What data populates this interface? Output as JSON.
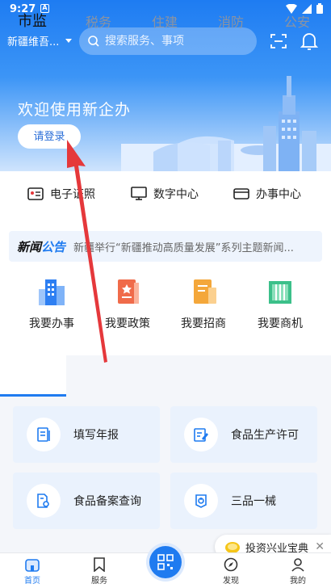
{
  "status_bar": {
    "time": "9:27",
    "badge": "A"
  },
  "header": {
    "region": "新疆维吾...",
    "search_placeholder": "搜索服务、事项"
  },
  "hero": {
    "welcome": "欢迎使用新企办",
    "login_label": "请登录"
  },
  "services": [
    {
      "label": "电子证照",
      "icon": "license-card-icon"
    },
    {
      "label": "数字中心",
      "icon": "monitor-icon"
    },
    {
      "label": "办事中心",
      "icon": "wallet-icon"
    }
  ],
  "news": {
    "tag_a": "新闻",
    "tag_b": "公告",
    "text": "新疆举行“新疆推动高质量发展”系列主题新闻..."
  },
  "quick_actions": [
    {
      "label": "我要办事",
      "icon": "building-icon"
    },
    {
      "label": "我要政策",
      "icon": "policy-book-icon"
    },
    {
      "label": "我要招商",
      "icon": "investment-icon"
    },
    {
      "label": "我要商机",
      "icon": "business-building-icon"
    }
  ],
  "tabs": [
    "市监",
    "税务",
    "住建",
    "消防",
    "公安"
  ],
  "tiles": [
    {
      "label": "填写年报",
      "icon": "report-icon"
    },
    {
      "label": "食品生产许可",
      "icon": "edit-form-icon"
    },
    {
      "label": "食品备案查询",
      "icon": "document-search-icon"
    },
    {
      "label": "三品一械",
      "icon": "power-icon"
    }
  ],
  "chip": {
    "label": "投资兴业宝典",
    "close": "✕"
  },
  "bottom_nav": [
    {
      "label": "首页",
      "icon": "home-icon"
    },
    {
      "label": "服务",
      "icon": "bookmark-icon"
    },
    {
      "label": "发现",
      "icon": "compass-icon"
    },
    {
      "label": "我的",
      "icon": "user-icon"
    }
  ],
  "colors": {
    "accent": "#1f7bf0",
    "annotation": "#e5383b"
  }
}
